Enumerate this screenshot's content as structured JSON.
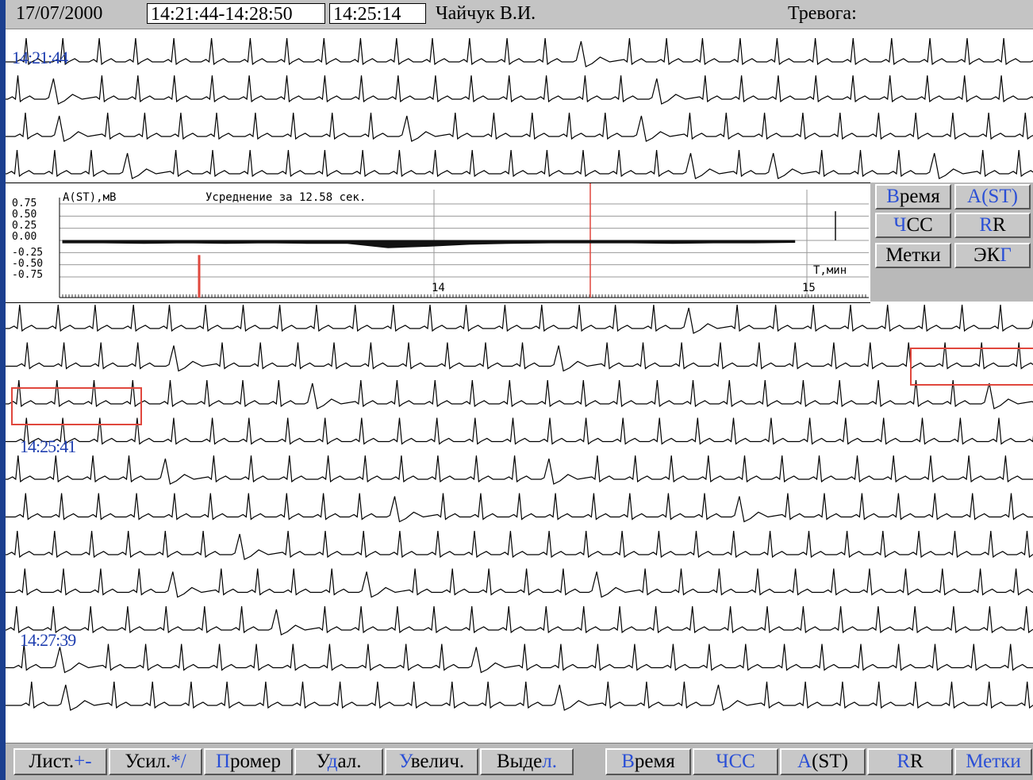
{
  "header": {
    "date": "17/07/2000",
    "interval": "14:21:44-14:28:50",
    "current_time": "14:25:14",
    "patient": "Чайчук В.И.",
    "alarm": "Тревога:"
  },
  "ecg_labels": {
    "top_start": "14:21:44",
    "mid": "14:25:41",
    "lower": "14:27:39"
  },
  "trend": {
    "title": "A(ST),мВ",
    "averaging": "Усреднение за 12.58 сек.",
    "y_ticks": [
      "0.75",
      "0.50",
      "0.25",
      "0.00",
      "-0.25",
      "-0.50",
      "-0.75"
    ],
    "x_ticks": [
      "14",
      "15"
    ],
    "x_unit": "Т,мин"
  },
  "right_buttons": [
    {
      "first": "В",
      "rest": "ремя",
      "first_blue": true
    },
    {
      "first": "A",
      "rest": "(ST)",
      "first_blue": true,
      "all_blue": true
    },
    {
      "first": "Ч",
      "rest": "СС",
      "first_blue": true
    },
    {
      "first": "R",
      "rest": "R",
      "first_blue": true
    },
    {
      "first": "М",
      "rest": "етки",
      "mid_blue": "е"
    },
    {
      "first": "ЭК",
      "rest": "Г",
      "last_blue": true
    }
  ],
  "toolbar": {
    "list": {
      "text": "Лист.",
      "accent": "+-"
    },
    "gain": {
      "text": "Усил.",
      "accent": "*/"
    },
    "measure": {
      "accent": "П",
      "text": "ромер"
    },
    "delete": {
      "pre": "У",
      "accent": "д",
      "post": "ал."
    },
    "zoom": {
      "accent": "У",
      "text": "велич."
    },
    "select": {
      "text": "Выде",
      "accent": "л."
    },
    "time": {
      "accent": "В",
      "text": "ремя"
    },
    "hr": {
      "accent": "Ч",
      "text": "СС"
    },
    "st": {
      "accent": "A",
      "text": "(ST)"
    },
    "rr": {
      "accent": "R",
      "text": "R"
    },
    "marks": {
      "pre": "М",
      "accent": "е",
      "post": "тки"
    }
  },
  "chart_data": {
    "type": "area",
    "title": "Усреднение за 12.58 сек.",
    "ylabel": "A(ST),мВ",
    "xlabel": "Т,мин",
    "ylim": [
      -0.75,
      0.75
    ],
    "x_ticks": [
      14,
      15
    ],
    "series": [
      {
        "values": [
          -0.05,
          -0.05,
          -0.06,
          -0.05,
          -0.06,
          -0.05,
          -0.06,
          -0.06,
          -0.15,
          -0.12,
          -0.08,
          -0.06,
          -0.05,
          -0.05,
          -0.05,
          -0.06,
          -0.05,
          -0.05,
          -0.04,
          0.6
        ]
      }
    ]
  },
  "colors": {
    "accent_blue": "#2a4fd6",
    "marker_red": "#e0473d",
    "label_blue": "#1f3fb0"
  }
}
